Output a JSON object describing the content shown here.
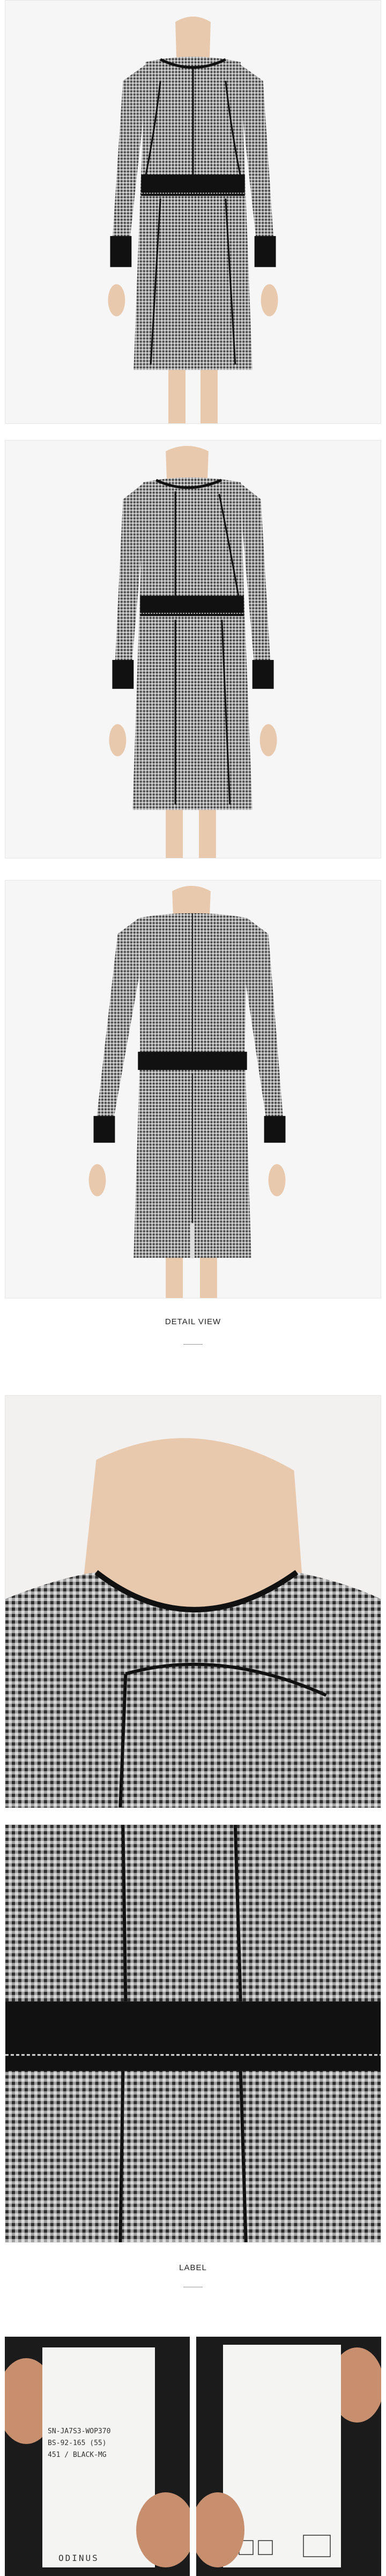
{
  "sections": {
    "detail_title": "DETAIL VIEW",
    "label_title": "LABEL"
  },
  "label_left": {
    "lines": [
      "SN-JA7S3-WOP370",
      "BS-92-165 (55)",
      "451 / BLACK-MG"
    ],
    "brand": "ODINUS"
  },
  "colors": {
    "fabric": "#8c8c8c",
    "trim": "#111111",
    "mannequin": "#e8c9ad",
    "background": "#f6f6f6"
  }
}
